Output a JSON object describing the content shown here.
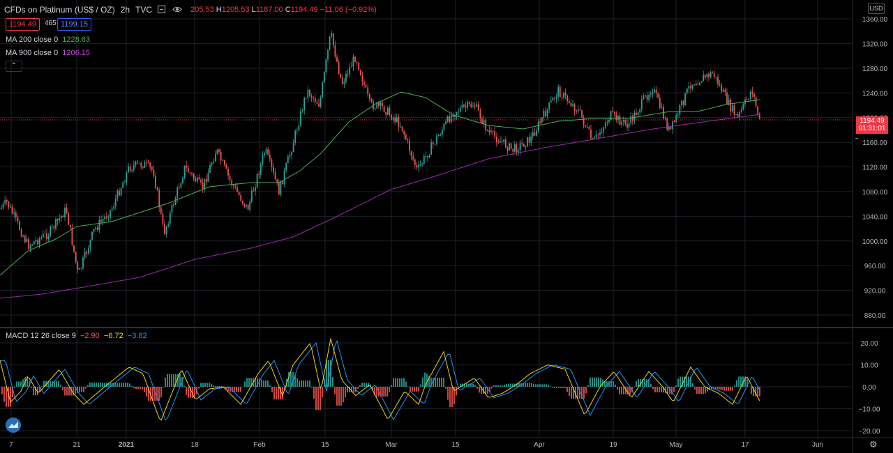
{
  "header": {
    "symbol": "CFDs on Platinum (US$ / OZ)",
    "interval": "2h",
    "exchange": "TVC",
    "ohlc_open": "205.53",
    "ohlc_high_label": "H",
    "ohlc_high": "1205.53",
    "ohlc_low_label": "L",
    "ohlc_low": "1187.00",
    "ohlc_close_label": "C",
    "ohlc_close": "1194.49",
    "change": "−11.06 (−0.92%)"
  },
  "quote": {
    "bid": "1194.49",
    "spread": "465",
    "ask": "1199.15"
  },
  "indicators": {
    "ma200_label": "MA 200 close 0",
    "ma200_value": "1228.63",
    "ma900_label": "MA 900 close 0",
    "ma900_value": "1206.15",
    "macd_label": "MACD 12 26 close 9",
    "macd_hist": "−2.90",
    "macd_line": "−6.72",
    "macd_signal": "−3.82"
  },
  "currency_button": "USD",
  "last_price_label": {
    "price": "1194.49",
    "countdown": "01:31:01"
  },
  "colors": {
    "up": "#26a69a",
    "down": "#ef5350",
    "ma200": "#4caf50",
    "ma900": "#9c27b0",
    "macd_line": "#f5d41c",
    "signal_line": "#2196f3",
    "grid": "#1e222d"
  },
  "chart_data": [
    {
      "type": "line",
      "title": "CFDs on Platinum (US$ / OZ)",
      "y_ticks": [
        1360,
        1320,
        1280,
        1240,
        1200,
        1160,
        1120,
        1080,
        1040,
        1000,
        960,
        920,
        880
      ],
      "ylim": [
        860,
        1375
      ],
      "x_ticks": [
        "7",
        "21",
        "2021",
        "18",
        "Feb",
        "15",
        "Mar",
        "15",
        "Apr",
        "19",
        "May",
        "17",
        "Jun"
      ],
      "series": [
        {
          "name": "price",
          "x": [
            "7",
            "21",
            "2021",
            "18",
            "Feb",
            "15",
            "Mar",
            "15",
            "Apr",
            "19",
            "May",
            "17"
          ],
          "values": [
            1060,
            1010,
            1070,
            1090,
            1085,
            1320,
            1180,
            1190,
            1200,
            1220,
            1240,
            1194
          ]
        },
        {
          "name": "MA 200 close 0",
          "values": [
            945,
            1030,
            1055,
            1075,
            1090,
            1200,
            1240,
            1200,
            1190,
            1200,
            1220,
            1228
          ]
        },
        {
          "name": "MA 900 close 0",
          "values": [
            905,
            920,
            935,
            965,
            990,
            1050,
            1095,
            1125,
            1145,
            1170,
            1185,
            1206
          ]
        }
      ]
    },
    {
      "type": "line",
      "title": "MACD 12 26 close 9",
      "y_ticks": [
        20,
        10,
        0,
        -10,
        -20
      ],
      "series": [
        {
          "name": "MACD",
          "values": [
            12,
            -8,
            9,
            -16,
            8,
            -6,
            22,
            -15,
            14,
            -8,
            9,
            -12,
            8,
            -10,
            6,
            -6.72
          ]
        },
        {
          "name": "Signal",
          "values": [
            10,
            -6,
            7,
            -14,
            7,
            -5,
            19,
            -13,
            12,
            -7,
            8,
            -10,
            7,
            -9,
            5,
            -3.82
          ]
        }
      ]
    }
  ]
}
